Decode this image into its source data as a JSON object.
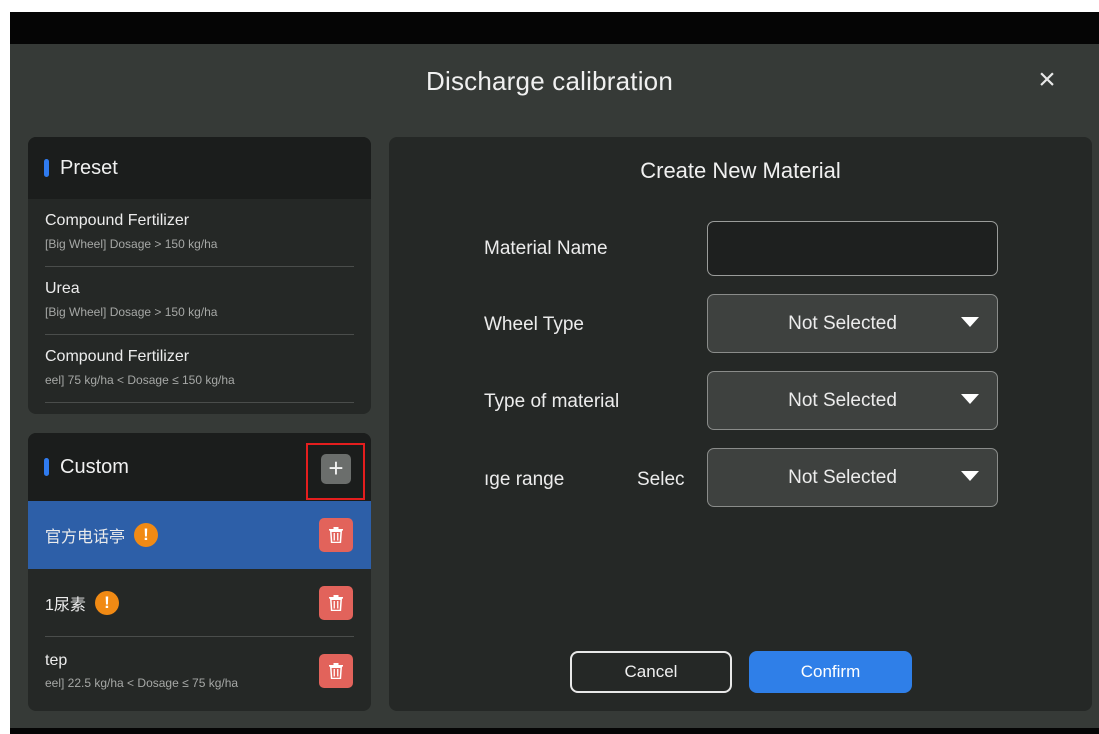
{
  "dialog": {
    "title": "Discharge calibration",
    "close_icon": "close-icon"
  },
  "preset": {
    "header": "Preset",
    "items": [
      {
        "name": "Compound Fertilizer",
        "desc": "[Big Wheel] Dosage > 150 kg/ha"
      },
      {
        "name": "Urea",
        "desc": "[Big Wheel] Dosage > 150 kg/ha"
      },
      {
        "name": "Compound Fertilizer",
        "desc": "eel] 75 kg/ha < Dosage ≤ 150 kg/ha"
      }
    ]
  },
  "custom": {
    "header": "Custom",
    "add_label": "+",
    "items": [
      {
        "name": "官方电话亭",
        "warning": "!",
        "selected": true
      },
      {
        "name": "1尿素",
        "warning": "!"
      },
      {
        "name": "tep",
        "desc": "eel] 22.5 kg/ha < Dosage ≤ 75 kg/ha"
      }
    ]
  },
  "form": {
    "title": "Create New Material",
    "material_name_label": "Material Name",
    "material_name_value": "",
    "wheel_type_label": "Wheel Type",
    "wheel_type_value": "Not Selected",
    "type_of_material_label": "Type of material",
    "type_of_material_value": "Not Selected",
    "dosage_range_label": "ıge range",
    "dosage_range_overlap_text": "Selec",
    "dosage_range_value": "Not Selected",
    "cancel_label": "Cancel",
    "confirm_label": "Confirm"
  },
  "colors": {
    "accent": "#2f7fe8",
    "selected_row": "#2d5fa8",
    "warning": "#f18a14",
    "delete": "#e2635b",
    "highlight_frame": "#e41e1e"
  }
}
